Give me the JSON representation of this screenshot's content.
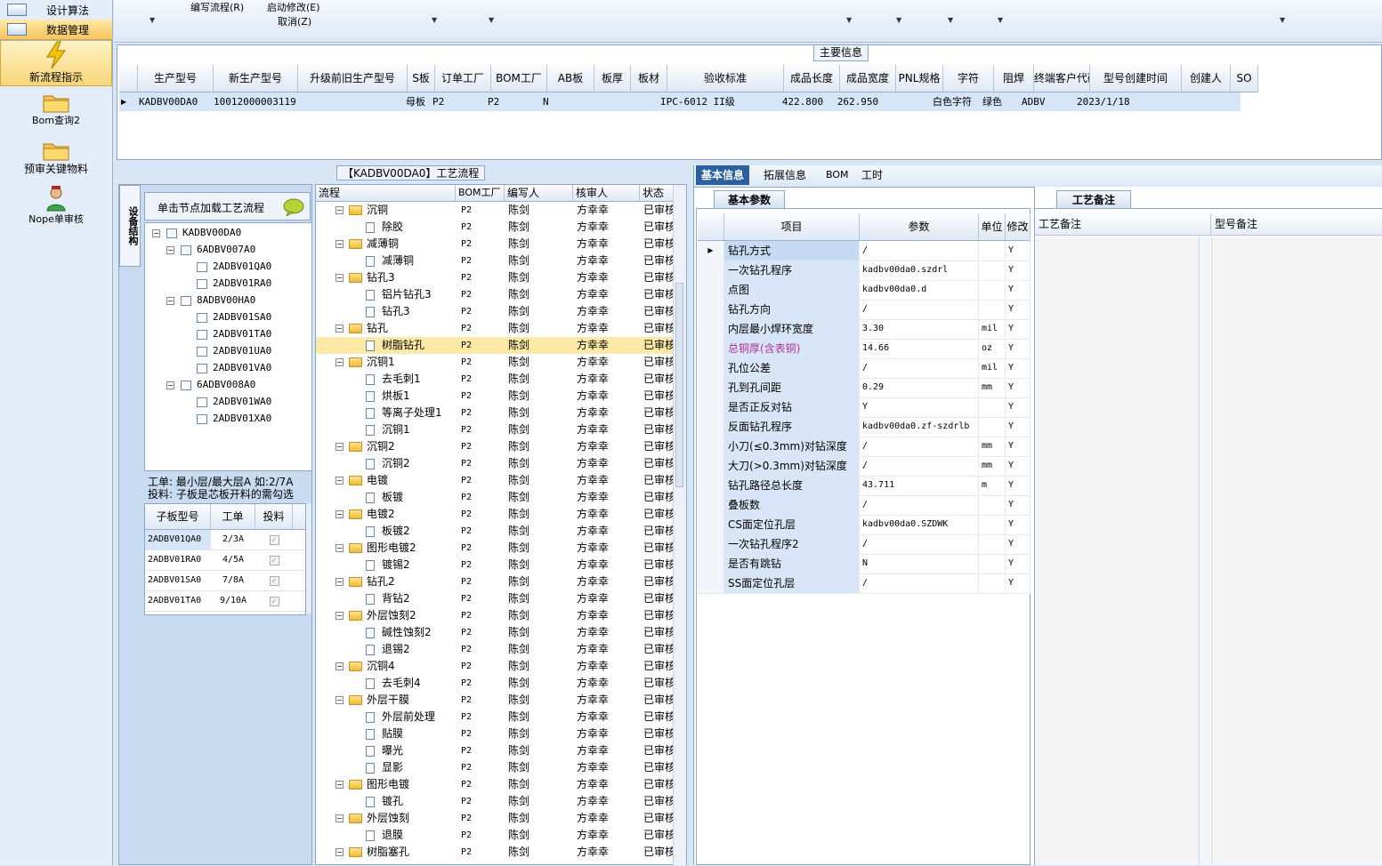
{
  "nav": {
    "design_algorithm": "设计算法",
    "data_management": "数据管理",
    "items": [
      "新流程指示",
      "Bom查询2",
      "预审关键物料",
      "Nope单审核"
    ]
  },
  "toolbar": {
    "edit_flow": "编写流程(R)",
    "start_modify": "启动修改(E)",
    "cancel": "取消(Z)"
  },
  "main_info": {
    "title": "主要信息",
    "columns": [
      "生产型号",
      "新生产型号",
      "升级前旧生产型号",
      "S板",
      "订单工厂",
      "BOM工厂",
      "AB板",
      "板厚",
      "板材",
      "验收标准",
      "成品长度",
      "成品宽度",
      "PNL规格",
      "字符",
      "阻焊",
      "终端客户代码",
      "型号创建时间",
      "创建人",
      "SO"
    ],
    "row": [
      "KADBV00DA0",
      "10012000003119",
      "",
      "母板",
      "P2",
      "P2",
      "N",
      "",
      "",
      "IPC-6012 II级",
      "422.800",
      "262.950",
      "",
      "白色字符",
      "绿色",
      "ADBV",
      "2023/1/18",
      "",
      ""
    ]
  },
  "structure": {
    "tab_label": "设备结构",
    "hint": "单击节点加载工艺流程",
    "tree": [
      {
        "label": "KADBV00DA0",
        "level": 0
      },
      {
        "label": "6ADBV007A0",
        "level": 1
      },
      {
        "label": "2ADBV01QA0",
        "level": 2
      },
      {
        "label": "2ADBV01RA0",
        "level": 2
      },
      {
        "label": "8ADBV00HA0",
        "level": 1
      },
      {
        "label": "2ADBV01SA0",
        "level": 2
      },
      {
        "label": "2ADBV01TA0",
        "level": 2
      },
      {
        "label": "2ADBV01UA0",
        "level": 2
      },
      {
        "label": "2ADBV01VA0",
        "level": 2
      },
      {
        "label": "6ADBV008A0",
        "level": 1
      },
      {
        "label": "2ADBV01WA0",
        "level": 2
      },
      {
        "label": "2ADBV01XA0",
        "level": 2
      }
    ],
    "note1": "工单: 最小层/最大层A 如:2/7A",
    "note2": "投料: 子板是芯板开料的需勾选",
    "sub_columns": [
      "子板型号",
      "工单",
      "投料"
    ],
    "sub_rows": [
      {
        "model": "2ADBV01QA0",
        "order": "2/3A"
      },
      {
        "model": "2ADBV01RA0",
        "order": "4/5A"
      },
      {
        "model": "2ADBV01SA0",
        "order": "7/8A"
      },
      {
        "model": "2ADBV01TA0",
        "order": "9/10A"
      }
    ]
  },
  "process": {
    "title": "【KADBV00DA0】工艺流程",
    "columns": [
      "流程",
      "BOM工厂",
      "编写人",
      "核审人",
      "状态"
    ],
    "factory": "P2",
    "writer": "陈剑",
    "reviewer": "方幸幸",
    "status": "已审核",
    "rows": [
      {
        "name": "沉铜",
        "type": "folder"
      },
      {
        "name": "除胶",
        "type": "doc"
      },
      {
        "name": "减薄铜",
        "type": "folder"
      },
      {
        "name": "减薄铜",
        "type": "doc"
      },
      {
        "name": "钻孔3",
        "type": "folder"
      },
      {
        "name": "铝片钻孔3",
        "type": "doc"
      },
      {
        "name": "钻孔3",
        "type": "doc"
      },
      {
        "name": "钻孔",
        "type": "folder"
      },
      {
        "name": "树脂钻孔",
        "type": "doc",
        "selected": true
      },
      {
        "name": "沉铜1",
        "type": "folder"
      },
      {
        "name": "去毛刺1",
        "type": "doc"
      },
      {
        "name": "烘板1",
        "type": "doc"
      },
      {
        "name": "等离子处理1",
        "type": "doc"
      },
      {
        "name": "沉铜1",
        "type": "doc"
      },
      {
        "name": "沉铜2",
        "type": "folder"
      },
      {
        "name": "沉铜2",
        "type": "doc"
      },
      {
        "name": "电镀",
        "type": "folder"
      },
      {
        "name": "板镀",
        "type": "doc"
      },
      {
        "name": "电镀2",
        "type": "folder"
      },
      {
        "name": "板镀2",
        "type": "doc"
      },
      {
        "name": "图形电镀2",
        "type": "folder"
      },
      {
        "name": "镀锡2",
        "type": "doc"
      },
      {
        "name": "钻孔2",
        "type": "folder"
      },
      {
        "name": "背钻2",
        "type": "doc"
      },
      {
        "name": "外层蚀刻2",
        "type": "folder"
      },
      {
        "name": "碱性蚀刻2",
        "type": "doc"
      },
      {
        "name": "退锡2",
        "type": "doc"
      },
      {
        "name": "沉铜4",
        "type": "folder"
      },
      {
        "name": "去毛刺4",
        "type": "doc"
      },
      {
        "name": "外层干膜",
        "type": "folder"
      },
      {
        "name": "外层前处理",
        "type": "doc"
      },
      {
        "name": "贴膜",
        "type": "doc"
      },
      {
        "name": "曝光",
        "type": "doc"
      },
      {
        "name": "显影",
        "type": "doc"
      },
      {
        "name": "图形电镀",
        "type": "folder"
      },
      {
        "name": "镀孔",
        "type": "doc"
      },
      {
        "name": "外层蚀刻",
        "type": "folder"
      },
      {
        "name": "退膜",
        "type": "doc"
      },
      {
        "name": "树脂塞孔",
        "type": "folder"
      }
    ]
  },
  "detail": {
    "tabs": [
      "基本信息",
      "拓展信息",
      "BOM",
      "工时"
    ],
    "subtab": "基本参数",
    "columns": [
      "项目",
      "参数",
      "单位",
      "修改"
    ],
    "rows": [
      {
        "item": "钻孔方式",
        "param": "/",
        "unit": "",
        "mod": "Y"
      },
      {
        "item": "一次钻孔程序",
        "param": "kadbv00da0.szdrl",
        "unit": "",
        "mod": "Y"
      },
      {
        "item": "点图",
        "param": "kadbv00da0.d",
        "unit": "",
        "mod": "Y"
      },
      {
        "item": "钻孔方向",
        "param": "/",
        "unit": "",
        "mod": "Y"
      },
      {
        "item": "内层最小焊环宽度",
        "param": "3.30",
        "unit": "mil",
        "mod": "Y"
      },
      {
        "item": "总铜厚(含表铜)",
        "param": "14.66",
        "unit": "oz",
        "mod": "Y",
        "highlight": true
      },
      {
        "item": "孔位公差",
        "param": "/",
        "unit": "mil",
        "mod": "Y"
      },
      {
        "item": "孔到孔间距",
        "param": "0.29",
        "unit": "mm",
        "mod": "Y"
      },
      {
        "item": "是否正反对钻",
        "param": "Y",
        "unit": "",
        "mod": "Y"
      },
      {
        "item": "反面钻孔程序",
        "param": "kadbv00da0.zf-szdrlb",
        "unit": "",
        "mod": "Y"
      },
      {
        "item": "小刀(≤0.3mm)对钻深度",
        "param": "/",
        "unit": "mm",
        "mod": "Y"
      },
      {
        "item": "大刀(>0.3mm)对钻深度",
        "param": "/",
        "unit": "mm",
        "mod": "Y"
      },
      {
        "item": "钻孔路径总长度",
        "param": "43.711",
        "unit": "m",
        "mod": "Y"
      },
      {
        "item": "叠板数",
        "param": "/",
        "unit": "",
        "mod": "Y"
      },
      {
        "item": "CS面定位孔层",
        "param": "kadbv00da0.SZDWK",
        "unit": "",
        "mod": "Y"
      },
      {
        "item": "一次钻孔程序2",
        "param": "/",
        "unit": "",
        "mod": "Y"
      },
      {
        "item": "是否有跳钻",
        "param": "N",
        "unit": "",
        "mod": "Y"
      },
      {
        "item": "SS面定位孔层",
        "param": "/",
        "unit": "",
        "mod": "Y"
      }
    ]
  },
  "remarks": {
    "tab": "工艺备注",
    "col1": "工艺备注",
    "col2": "型号备注"
  },
  "colors": {
    "accent": "#2b5f9e",
    "selected_row": "#fde9a6",
    "highlight_text": "#b0309a"
  }
}
